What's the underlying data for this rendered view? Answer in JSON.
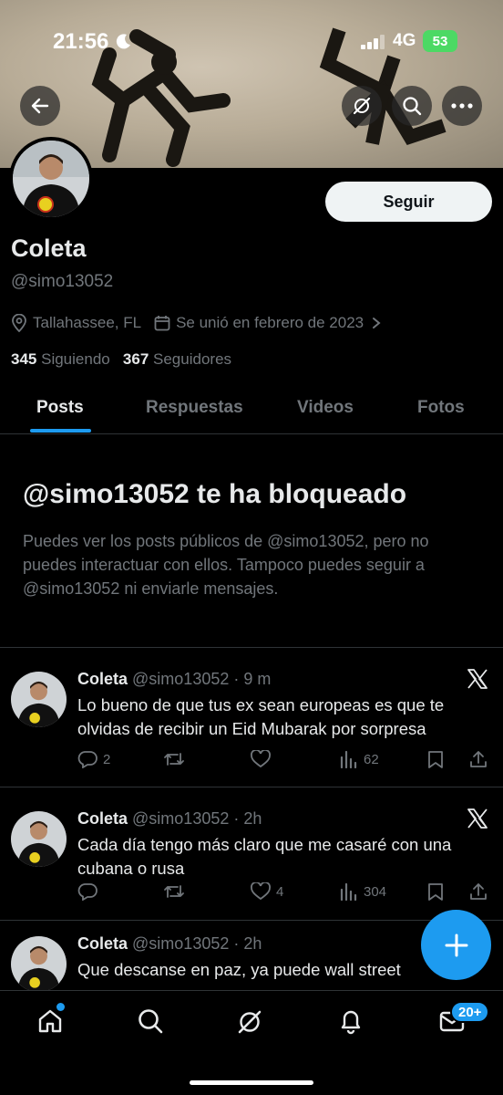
{
  "status_bar": {
    "time": "21:56",
    "network": "4G",
    "battery": "53"
  },
  "header_icons": [
    "back-arrow-icon",
    "grok-icon",
    "search-icon",
    "more-icon"
  ],
  "profile": {
    "follow_label": "Seguir",
    "name": "Coleta",
    "handle": "@simo13052",
    "location": "Tallahassee, FL",
    "joined": "Se unió en febrero de 2023",
    "following_count": "345",
    "following_label": "Siguiendo",
    "followers_count": "367",
    "followers_label": "Seguidores"
  },
  "tabs": [
    {
      "label": "Posts",
      "active": true
    },
    {
      "label": "Respuestas",
      "active": false
    },
    {
      "label": "Videos",
      "active": false
    },
    {
      "label": "Fotos",
      "active": false
    }
  ],
  "blocked": {
    "title": "@simo13052 te ha bloqueado",
    "text": "Puedes ver los posts públicos de @simo13052, pero no puedes interactuar con ellos. Tampoco puedes seguir a @simo13052 ni enviarle mensajes."
  },
  "posts": [
    {
      "author": "Coleta",
      "meta": "@simo13052 · 9 m",
      "text": "Lo bueno de que tus ex sean europeas es que te olvidas de recibir un Eid Mubarak por sorpresa",
      "replies": "2",
      "reposts": "",
      "likes": "",
      "views": "62"
    },
    {
      "author": "Coleta",
      "meta": "@simo13052 · 2h",
      "text": "Cada día tengo más claro que me casaré con una cubana o rusa",
      "replies": "",
      "reposts": "",
      "likes": "4",
      "views": "304"
    },
    {
      "author": "Coleta",
      "meta": "@simo13052 · 2h",
      "text": "Que descanse en paz, ya puede wall street",
      "replies": "",
      "reposts": "",
      "likes": "",
      "views": ""
    }
  ],
  "bottom_nav": {
    "items": [
      "home-icon",
      "search-icon",
      "grok-icon",
      "notifications-icon",
      "messages-icon"
    ],
    "messages_badge": "20+"
  },
  "colors": {
    "accent": "#1d9bf0",
    "background": "#000000",
    "secondary_text": "#71767b"
  }
}
